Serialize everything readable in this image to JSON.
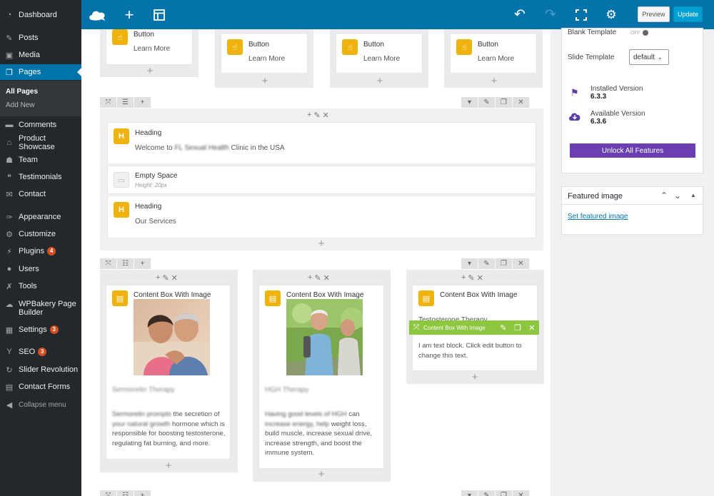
{
  "sidebar": {
    "items": [
      {
        "label": "Dashboard",
        "icon": "gauge-icon"
      },
      {
        "label": "Posts",
        "icon": "pin-icon"
      },
      {
        "label": "Media",
        "icon": "media-icon"
      },
      {
        "label": "Pages",
        "icon": "pages-icon",
        "active": true
      },
      {
        "label": "Comments",
        "icon": "comment-icon"
      },
      {
        "label": "Product Showcase",
        "icon": "store-icon"
      },
      {
        "label": "Team",
        "icon": "team-icon"
      },
      {
        "label": "Testimonials",
        "icon": "quote-icon"
      },
      {
        "label": "Contact",
        "icon": "mail-icon"
      },
      {
        "label": "Appearance",
        "icon": "brush-icon"
      },
      {
        "label": "Customize",
        "icon": "gear-icon"
      },
      {
        "label": "Plugins",
        "icon": "plug-icon",
        "badge": "4"
      },
      {
        "label": "Users",
        "icon": "user-icon"
      },
      {
        "label": "Tools",
        "icon": "wrench-icon"
      },
      {
        "label": "WPBakery Page Builder",
        "icon": "cloud-icon"
      },
      {
        "label": "Settings",
        "icon": "settings-icon",
        "badge": "3"
      },
      {
        "label": "SEO",
        "icon": "seo-icon",
        "badge": "3"
      },
      {
        "label": "Slider Revolution",
        "icon": "refresh-icon"
      },
      {
        "label": "Contact Forms",
        "icon": "form-icon"
      }
    ],
    "submenu": [
      "All Pages",
      "Add New"
    ],
    "collapse": "Collapse menu"
  },
  "toolbar": {
    "preview": "Preview",
    "update": "Update"
  },
  "editor": {
    "buttons_row": [
      {
        "title": "Button",
        "sub": "Learn More"
      },
      {
        "title": "Button",
        "sub": "Learn More"
      },
      {
        "title": "Button",
        "sub": "Learn More"
      },
      {
        "title": "Button",
        "sub": "Learn More"
      }
    ],
    "heading1": {
      "icon_letter": "H",
      "title": "Heading",
      "sub_pre": "Welcome to",
      "sub_blur": "FL Sexual Health",
      "sub_post": "Clinic in the USA"
    },
    "empty_space": {
      "title": "Empty Space",
      "sub": "Height: 20px"
    },
    "heading2": {
      "icon_letter": "H",
      "title": "Heading",
      "sub": "Our Services"
    },
    "content_boxes": [
      {
        "title": "Content Box With Image",
        "heading": "Sermorelin Therapy",
        "text_blur": "Sermorelin prompts",
        "text1": "the secretion of",
        "text2_blur": "your natural growth",
        "text2": "hormone which is",
        "text3": "responsible for boosting testosterone,",
        "text4": "regulating fat burning, and more."
      },
      {
        "title": "Content Box With Image",
        "heading": "HGH Therapy",
        "text_blur": "Having good levels of HGH",
        "text1": "can",
        "text2_blur": "increase energy, help",
        "text2": "weight loss,",
        "text3": "build muscle, increase sexual drive,",
        "text4": "increase strength, and boost the",
        "text5": "immune system."
      },
      {
        "title": "Content Box With Image",
        "heading": "Testosterone Therapy",
        "greenbar": "Content Box With Image",
        "text1": "I am text block. Click edit button to",
        "text2": "change this text."
      }
    ]
  },
  "side": {
    "blank_template": "Blank Template",
    "toggle": "OFF",
    "slide_template": "Slide Template",
    "slide_template_value": "default",
    "installed_label": "Installed Version",
    "installed_value": "6.3.3",
    "available_label": "Available Version",
    "available_value": "6.3.6",
    "unlock": "Unlock All Features",
    "featured_title": "Featured image",
    "featured_link": "Set featured image"
  },
  "colors": {
    "toolbar": "#0473aa",
    "sidebar": "#23282d",
    "accent_yellow": "#f0b30d",
    "accent_green": "#8dc63f",
    "accent_purple": "#6b3fb1"
  }
}
